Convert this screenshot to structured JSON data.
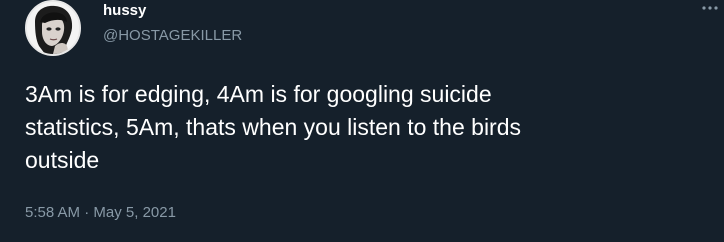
{
  "author": {
    "display_name": "hussy",
    "handle": "@HOSTAGEKILLER"
  },
  "tweet": {
    "text": "3Am is for edging, 4Am is for googling suicide\nstatistics, 5Am, thats when you listen to the birds\noutside",
    "time": "5:58 AM",
    "separator": " · ",
    "date": "May 5, 2021"
  },
  "icons": {
    "more": "more-options-icon"
  },
  "colors": {
    "background": "#15202b",
    "primary_text": "#ffffff",
    "secondary_text": "#8899a6"
  }
}
